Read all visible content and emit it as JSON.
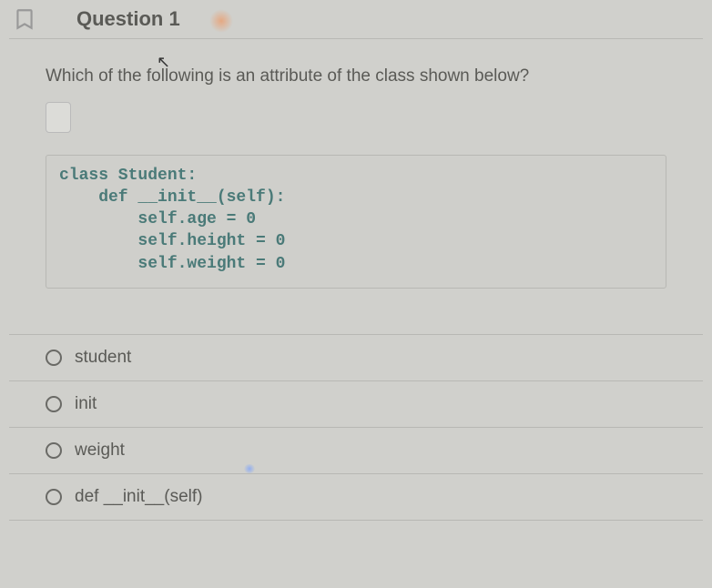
{
  "header": {
    "title": "Question 1"
  },
  "question": {
    "prompt": "Which of the following is an attribute of the class shown below?",
    "code": "class Student:\n    def __init__(self):\n        self.age = 0\n        self.height = 0\n        self.weight = 0"
  },
  "options": [
    {
      "label": "student"
    },
    {
      "label": "init"
    },
    {
      "label": "weight"
    },
    {
      "label": "def __init__(self)"
    }
  ]
}
